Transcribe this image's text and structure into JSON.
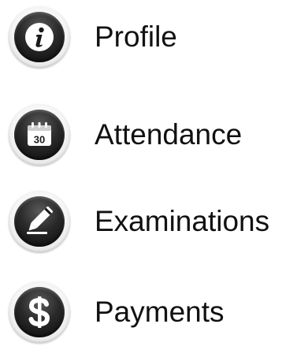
{
  "menu": {
    "items": [
      {
        "label": "Profile",
        "icon": "info-icon"
      },
      {
        "label": "Attendance",
        "icon": "calendar-icon"
      },
      {
        "label": "Examinations",
        "icon": "pencil-icon"
      },
      {
        "label": "Payments",
        "icon": "dollar-icon"
      }
    ]
  },
  "icons": {
    "calendar_day": "30"
  },
  "colors": {
    "icon_fill": "#1a1a1a",
    "icon_ring": "#f2f2f2",
    "text": "#111111"
  }
}
